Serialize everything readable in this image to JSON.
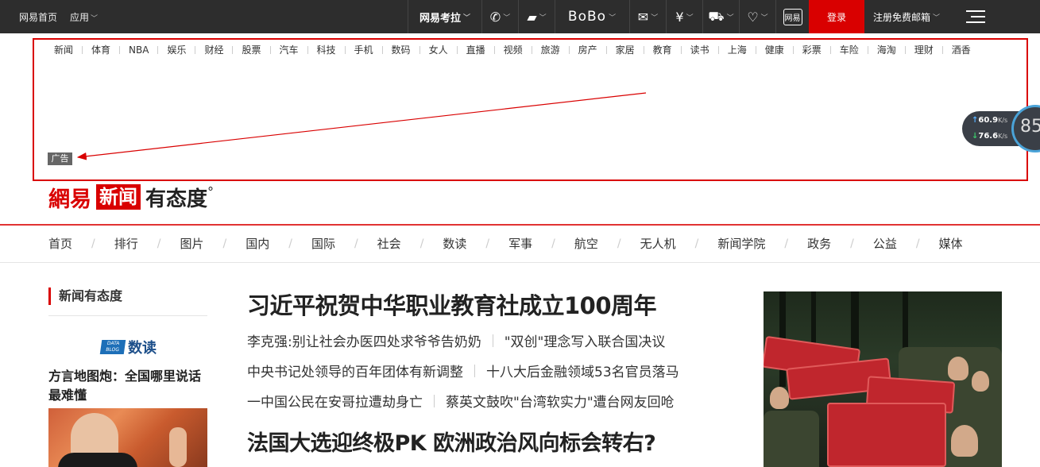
{
  "topbar": {
    "home": "网易首页",
    "apps": "应用",
    "kaola": "网易考拉",
    "bobo": "BoBo",
    "mobile": "网易",
    "login": "登录",
    "register": "注册免费邮箱"
  },
  "channels": [
    "新闻",
    "体育",
    "NBA",
    "娱乐",
    "财经",
    "股票",
    "汽车",
    "科技",
    "手机",
    "数码",
    "女人",
    "直播",
    "视频",
    "旅游",
    "房产",
    "家居",
    "教育",
    "读书",
    "上海",
    "健康",
    "彩票",
    "车险",
    "海淘",
    "理财",
    "酒香"
  ],
  "ad_tag": "广告",
  "speed": {
    "up": "60.9",
    "down": "76.6",
    "unit": "K/s",
    "score": "85"
  },
  "logo": {
    "wy": "網易",
    "xw": "新闻",
    "ytd": "有态度",
    "deg": "°"
  },
  "mainnav": [
    "首页",
    "排行",
    "图片",
    "国内",
    "国际",
    "社会",
    "数读",
    "军事",
    "航空",
    "无人机",
    "新闻学院",
    "政务",
    "公益",
    "媒体"
  ],
  "left": {
    "title": "新闻有态度",
    "data_logo": "DATA BLOG",
    "data_text": "数读",
    "headline": "方言地图炮：全国哪里说话最难懂"
  },
  "center": {
    "headline1": "习近平祝贺中华职业教育社成立100周年",
    "rows": [
      [
        "李克强:别让社会办医四处求爷爷告奶奶",
        "\"双创\"理念写入联合国决议"
      ],
      [
        "中央书记处领导的百年团体有新调整",
        "十八大后金融领域53名官员落马"
      ],
      [
        "一中国公民在安哥拉遭劫身亡",
        "蔡英文鼓吹\"台湾软实力\"遭台网友回呛"
      ]
    ],
    "headline2": "法国大选迎终极PK 欧洲政治风向标会转右?"
  },
  "colors": {
    "accent": "#d90000",
    "topbar": "#2d2d2d"
  }
}
